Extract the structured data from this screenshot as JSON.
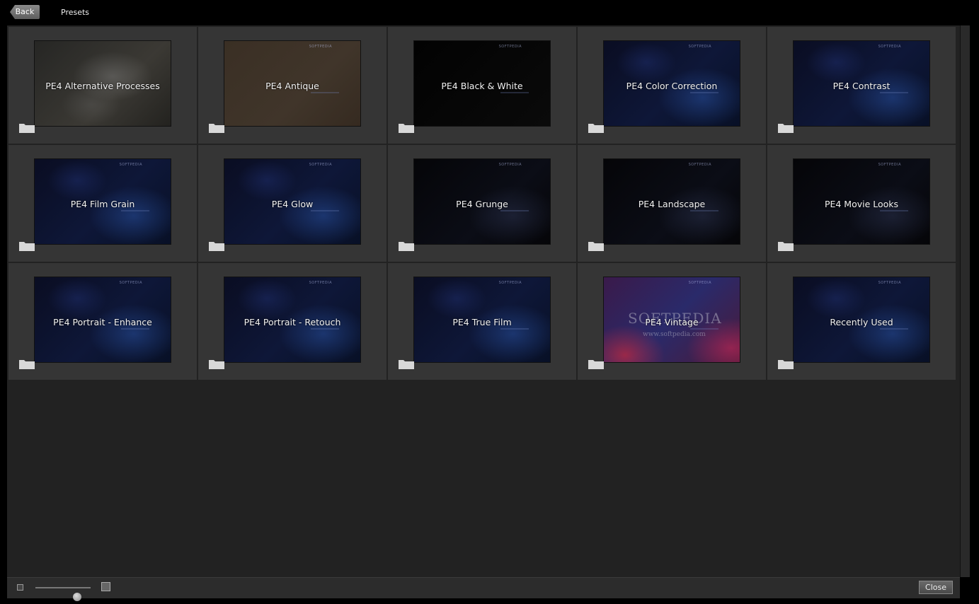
{
  "header": {
    "back_label": "Back",
    "title": "Presets"
  },
  "presets": [
    {
      "label": "PE4 Alternative Processes",
      "thumb": "gray"
    },
    {
      "label": "PE4 Antique",
      "thumb": "sepia"
    },
    {
      "label": "PE4 Black & White",
      "thumb": "black"
    },
    {
      "label": "PE4 Color Correction",
      "thumb": "blue"
    },
    {
      "label": "PE4 Contrast",
      "thumb": "blue"
    },
    {
      "label": "PE4 Film Grain",
      "thumb": "blue"
    },
    {
      "label": "PE4 Glow",
      "thumb": "blue"
    },
    {
      "label": "PE4 Grunge",
      "thumb": "dark"
    },
    {
      "label": "PE4 Landscape",
      "thumb": "dark"
    },
    {
      "label": "PE4 Movie Looks",
      "thumb": "dark"
    },
    {
      "label": "PE4 Portrait - Enhance",
      "thumb": "blue"
    },
    {
      "label": "PE4 Portrait - Retouch",
      "thumb": "blue"
    },
    {
      "label": "PE4 True Film",
      "thumb": "blue"
    },
    {
      "label": "PE4 Vintage",
      "thumb": "purple"
    },
    {
      "label": "Recently Used",
      "thumb": "blue"
    }
  ],
  "thumbnail_mark": "SOFTPEDIA",
  "watermark": {
    "name": "SOFTPEDIA",
    "url": "www.softpedia.com"
  },
  "footer": {
    "zoom_level": 0.75,
    "close_label": "Close"
  },
  "icons": {
    "folder": "folder-icon",
    "back": "back-arrow-icon",
    "small_size": "small-thumbnail-icon",
    "large_size": "large-thumbnail-icon"
  },
  "colors": {
    "background": "#000000",
    "panel": "#222222",
    "tile": "#353535"
  }
}
